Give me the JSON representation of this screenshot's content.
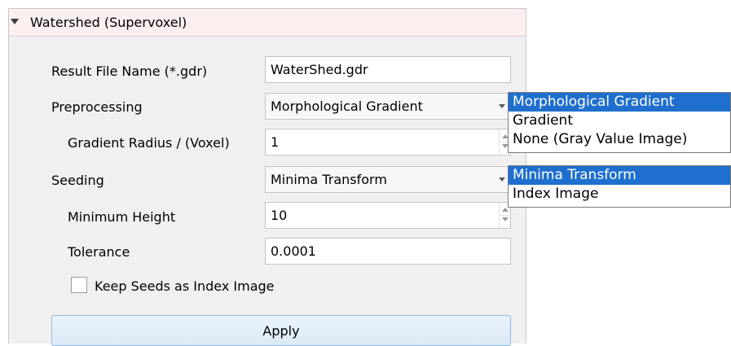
{
  "panel": {
    "title": "Watershed (Supervoxel)"
  },
  "form": {
    "result_file_name_label": "Result File Name (*.gdr)",
    "result_file_name_value": "WaterShed.gdr",
    "preprocessing_label": "Preprocessing",
    "preprocessing_value": "Morphological Gradient",
    "gradient_radius_label": "Gradient Radius / (Voxel)",
    "gradient_radius_value": "1",
    "seeding_label": "Seeding",
    "seeding_value": "Minima Transform",
    "minimum_height_label": "Minimum Height",
    "minimum_height_value": "10",
    "tolerance_label": "Tolerance",
    "tolerance_value": "0.0001",
    "keep_seeds_label": "Keep Seeds as Index Image",
    "keep_seeds_checked": false,
    "apply_label": "Apply"
  },
  "preprocessing_dropdown": {
    "options": [
      "Morphological Gradient",
      "Gradient",
      "None (Gray Value Image)"
    ],
    "selected": "Morphological Gradient"
  },
  "seeding_dropdown": {
    "options": [
      "Minima Transform",
      "Index Image"
    ],
    "selected": "Minima Transform"
  },
  "colors": {
    "selection": "#1f6fce",
    "header_bg": "#fbeff0",
    "panel_bg": "#f0f0f0"
  }
}
